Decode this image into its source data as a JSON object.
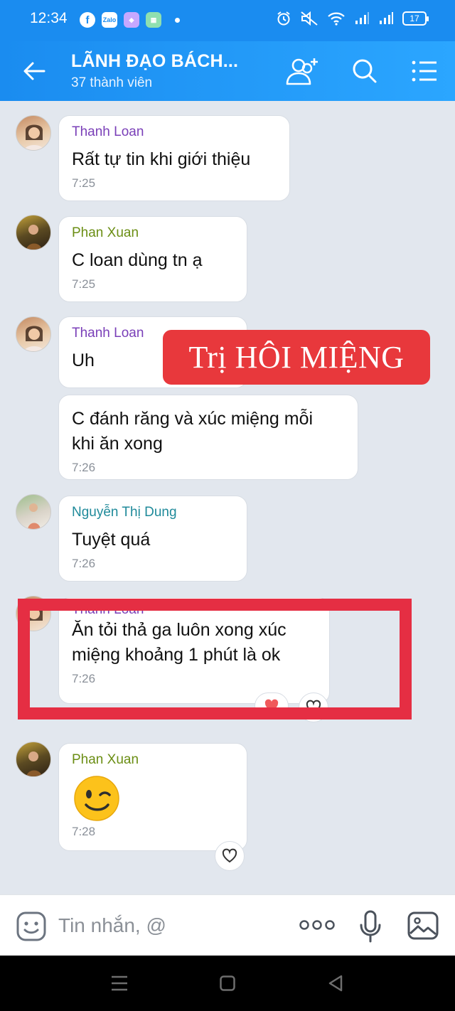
{
  "status_bar": {
    "time": "12:34",
    "battery": "17",
    "app_icons": [
      "facebook-icon",
      "zalo-icon",
      "shortcut-icon",
      "calendar-app-icon"
    ]
  },
  "header": {
    "title": "LÃNH ĐẠO BÁCH...",
    "subtitle": "37 thành viên"
  },
  "messages": [
    {
      "sender": "Thanh Loan",
      "sender_color": "#7a3fb8",
      "text": "Rất tự tin khi giới thiệu",
      "time": "7:25"
    },
    {
      "sender": "Phan Xuan",
      "sender_color": "#6b8e14",
      "text": "C loan dùng tn ạ",
      "time": "7:25"
    },
    {
      "sender": "Thanh Loan",
      "sender_color": "#7a3fb8",
      "text": "Uh",
      "time": ""
    },
    {
      "sender": "",
      "text_lines": [
        "C đánh răng và xúc miệng mỗi",
        "khi ăn xong"
      ],
      "time": "7:26"
    },
    {
      "sender": "Nguyễn Thị Dung",
      "sender_color": "#1f8a9a",
      "text": "Tuyệt quá",
      "time": "7:26"
    },
    {
      "sender": "Thanh Loan",
      "sender_color": "#7a3fb8",
      "text_lines": [
        "Ăn tỏi thả ga luôn xong xúc",
        "miệng khoảng 1 phút là ok"
      ],
      "time": "7:26"
    },
    {
      "sender": "Phan Xuan",
      "sender_color": "#6b8e14",
      "emoji": "wink",
      "time": "7:28"
    }
  ],
  "overlay_label": "Trị HÔI MIỆNG",
  "input": {
    "placeholder": "Tin nhắn, @"
  },
  "colors": {
    "header_blue": "#1a8cf0",
    "highlight_red": "#e52e43",
    "label_red": "#e8383c"
  }
}
